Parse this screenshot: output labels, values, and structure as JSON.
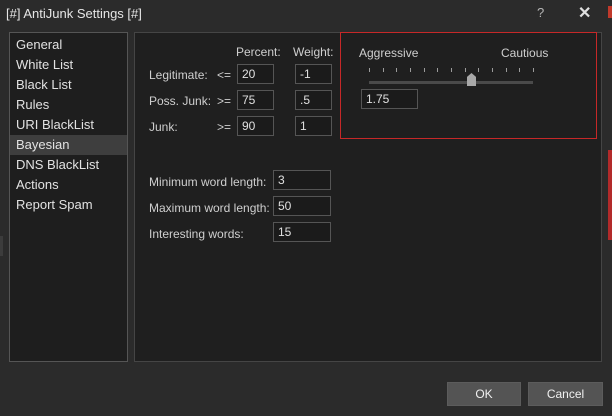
{
  "window": {
    "title": "[#] AntiJunk Settings [#]",
    "help_label": "?",
    "close_label": "✕"
  },
  "sidebar": {
    "items": [
      {
        "label": "General"
      },
      {
        "label": "White List"
      },
      {
        "label": "Black List"
      },
      {
        "label": "Rules"
      },
      {
        "label": "URI BlackList"
      },
      {
        "label": "Bayesian",
        "selected": true
      },
      {
        "label": "DNS BlackList"
      },
      {
        "label": "Actions"
      },
      {
        "label": "Report Spam"
      }
    ]
  },
  "bayesian": {
    "headers": {
      "percent": "Percent:",
      "weight": "Weight:"
    },
    "rows": [
      {
        "label": "Legitimate:",
        "op": "<=",
        "percent": "20",
        "weight": "-1"
      },
      {
        "label": "Poss. Junk:",
        "op": ">=",
        "percent": "75",
        "weight": ".5"
      },
      {
        "label": "Junk:",
        "op": ">=",
        "percent": "90",
        "weight": "1"
      }
    ],
    "settings": [
      {
        "label": "Minimum word length:",
        "value": "3"
      },
      {
        "label": "Maximum word length:",
        "value": "50"
      },
      {
        "label": "Interesting words:",
        "value": "15"
      }
    ],
    "slider": {
      "left_label": "Aggressive",
      "right_label": "Cautious",
      "value": "1.75",
      "position_fraction": 0.62,
      "tick_count": 13
    }
  },
  "buttons": {
    "ok": "OK",
    "cancel": "Cancel"
  },
  "colors": {
    "highlight_border": "#c62828",
    "selected_item": "#3e3e3e"
  }
}
